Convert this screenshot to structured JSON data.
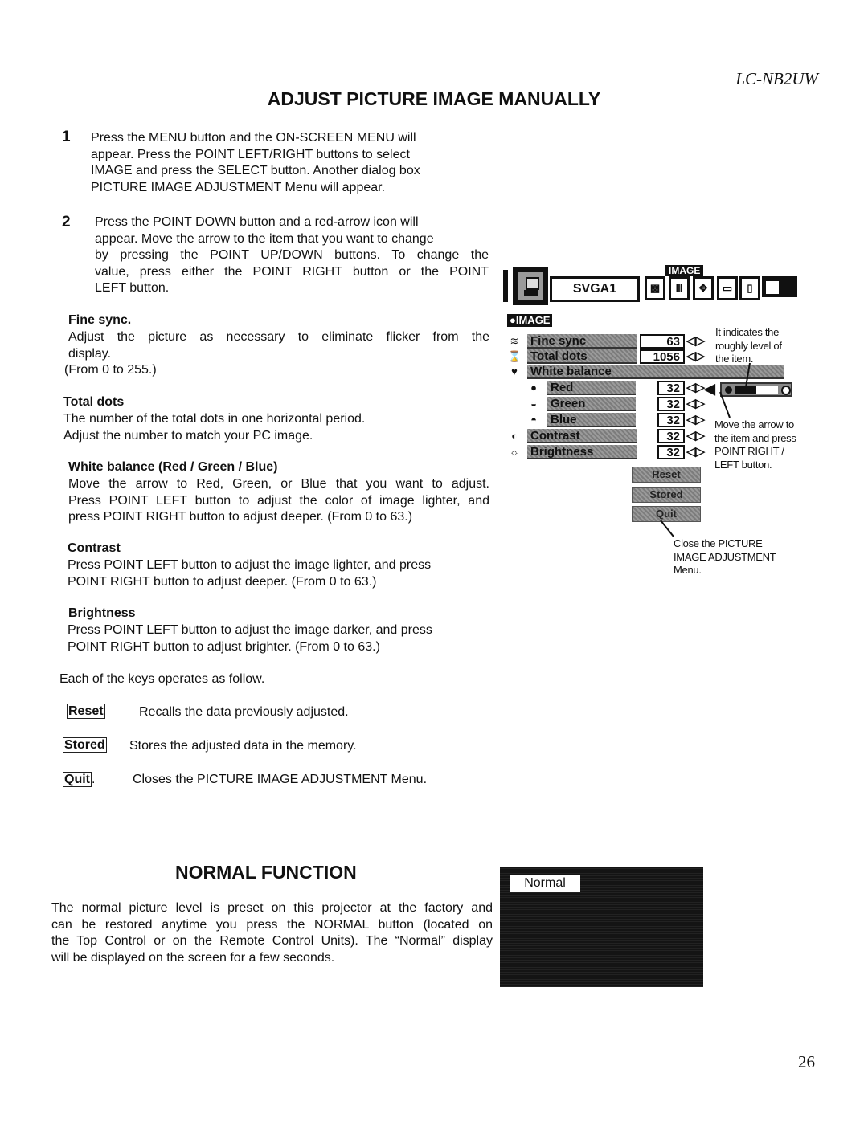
{
  "header": {
    "model": "LC-NB2UW",
    "title": "ADJUST PICTURE IMAGE MANUALLY"
  },
  "steps": [
    {
      "num": "1",
      "lines": [
        "Press the MENU button and the ON-SCREEN MENU will",
        "appear. Press the POINT LEFT/RIGHT buttons to select",
        "IMAGE and press the SELECT button. Another dialog box",
        "PICTURE IMAGE ADJUSTMENT Menu will appear."
      ]
    },
    {
      "num": "2",
      "lines": [
        "Press the POINT DOWN button and a red-arrow icon will",
        "appear. Move the arrow to the item that you want to change",
        "by pressing the POINT UP/DOWN buttons. To change the",
        "value, press either the POINT RIGHT button or the POINT",
        "LEFT button."
      ]
    }
  ],
  "items": [
    {
      "heading": "Fine sync.",
      "lines": [
        "Adjust the picture as necessary to eliminate flicker from the",
        "display.",
        "(From 0 to 255.)"
      ]
    },
    {
      "heading": "Total dots",
      "lines": [
        "The number of the total dots in one horizontal period.",
        "Adjust the number to match your PC image."
      ]
    },
    {
      "heading": "White balance (Red / Green / Blue)",
      "lines": [
        "Move the arrow to Red, Green, or Blue that you want to adjust.",
        "Press POINT LEFT button to adjust the color of image lighter, and",
        "press POINT RIGHT button to adjust deeper. (From 0 to 63.)"
      ]
    },
    {
      "heading": "Contrast",
      "lines": [
        "Press POINT LEFT button to adjust the image lighter, and press",
        "POINT RIGHT button to adjust deeper. (From 0 to 63.)"
      ]
    },
    {
      "heading": "Brightness",
      "lines": [
        "Press POINT LEFT button to adjust the image darker, and press",
        "POINT RIGHT button to adjust brighter. (From 0 to 63.)"
      ]
    }
  ],
  "keys_intro": "Each of the keys operates as follow.",
  "keys": [
    {
      "key": "Reset",
      "desc": "Recalls the data previously adjusted."
    },
    {
      "key": "Stored",
      "desc": "Stores the adjusted data in the memory."
    },
    {
      "key": "Quit",
      "suffix": ".",
      "desc": "Closes the PICTURE IMAGE ADJUSTMENT Menu."
    }
  ],
  "osd": {
    "tab_label": "IMAGE",
    "source": "SVGA1",
    "menu_title": "IMAGE",
    "rows": [
      {
        "label": "Fine sync",
        "value": "63",
        "icon": "fine-sync-icon",
        "glyph": "≋"
      },
      {
        "label": "Total dots",
        "value": "1056",
        "icon": "total-dots-icon",
        "glyph": "⌛"
      },
      {
        "label": "White balance",
        "value": "",
        "icon": "white-balance-icon",
        "glyph": "♥"
      },
      {
        "label": "Red",
        "value": "32",
        "icon": "red-icon",
        "glyph": "●"
      },
      {
        "label": "Green",
        "value": "32",
        "icon": "green-icon",
        "glyph": "◒"
      },
      {
        "label": "Blue",
        "value": "32",
        "icon": "blue-icon",
        "glyph": "◓"
      },
      {
        "label": "Contrast",
        "value": "32",
        "icon": "contrast-icon",
        "glyph": "◐"
      },
      {
        "label": "Brightness",
        "value": "32",
        "icon": "brightness-icon",
        "glyph": "☼"
      }
    ],
    "arrow_glyph": "◁▷",
    "buttons": [
      "Reset",
      "Stored",
      "Quit"
    ],
    "level_fraction": 0.5,
    "callouts": {
      "level": [
        "It indicates the",
        "roughly level of",
        "the item."
      ],
      "arrow": [
        "Move the arrow to",
        "the item and press",
        "POINT RIGHT /",
        "LEFT button."
      ],
      "quit": [
        "Close the PICTURE",
        "IMAGE ADJUSTMENT",
        "Menu."
      ]
    }
  },
  "normal": {
    "title": "NORMAL FUNCTION",
    "lines": [
      "The normal picture level is preset on this projector at the factory and",
      "can be restored anytime you press the NORMAL button (located on",
      "the Top Control or on the Remote Control Units). The “Normal” display",
      "will be displayed on the screen for a few seconds."
    ],
    "screen_label": "Normal"
  },
  "page_number": "26"
}
